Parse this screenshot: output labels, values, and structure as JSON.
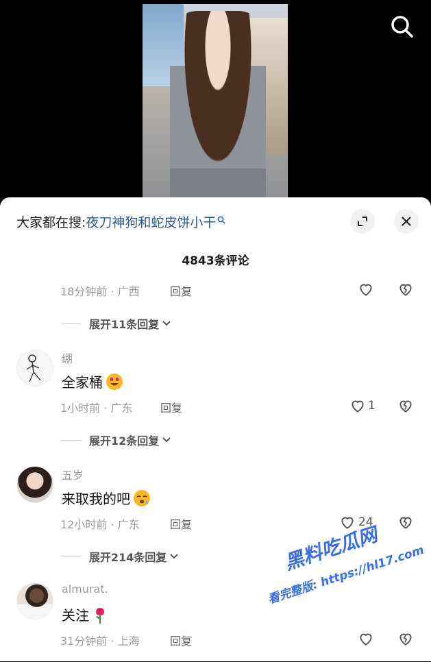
{
  "header": {
    "search_icon": "search-icon"
  },
  "sheet": {
    "suggest_prefix": "大家都在搜:",
    "suggest_keyword": "夜刀神狗和蛇皮饼小干",
    "comment_count": "4843条评论",
    "expand_icon": "expand-icon",
    "close_icon": "close-icon"
  },
  "comments": [
    {
      "meta": "18分钟前 · 广西",
      "reply": "回复",
      "likes": "",
      "expand": "展开11条回复"
    },
    {
      "username": "绷",
      "text": "全家桶",
      "emoji": "heart-eyes-emoji",
      "meta": "1小时前 · 广东",
      "reply": "回复",
      "likes": "1",
      "expand": "展开12条回复"
    },
    {
      "username": "五岁",
      "text": "来取我的吧",
      "emoji": "sleepy-emoji",
      "meta": "12小时前 · 广东",
      "reply": "回复",
      "likes": "24",
      "expand": "展开214条回复"
    },
    {
      "username": "almurat.",
      "text": "关注",
      "emoji": "rose-emoji",
      "meta": "31分钟前 · 上海",
      "reply": "回复",
      "likes": ""
    }
  ],
  "watermark": {
    "line1": "黑料吃瓜网",
    "line2": "看完整版: https://hl17.com"
  },
  "colors": {
    "keyword": "#2b5b8f",
    "meta": "#9a9a9a",
    "watermark": "#3a6fe8"
  }
}
